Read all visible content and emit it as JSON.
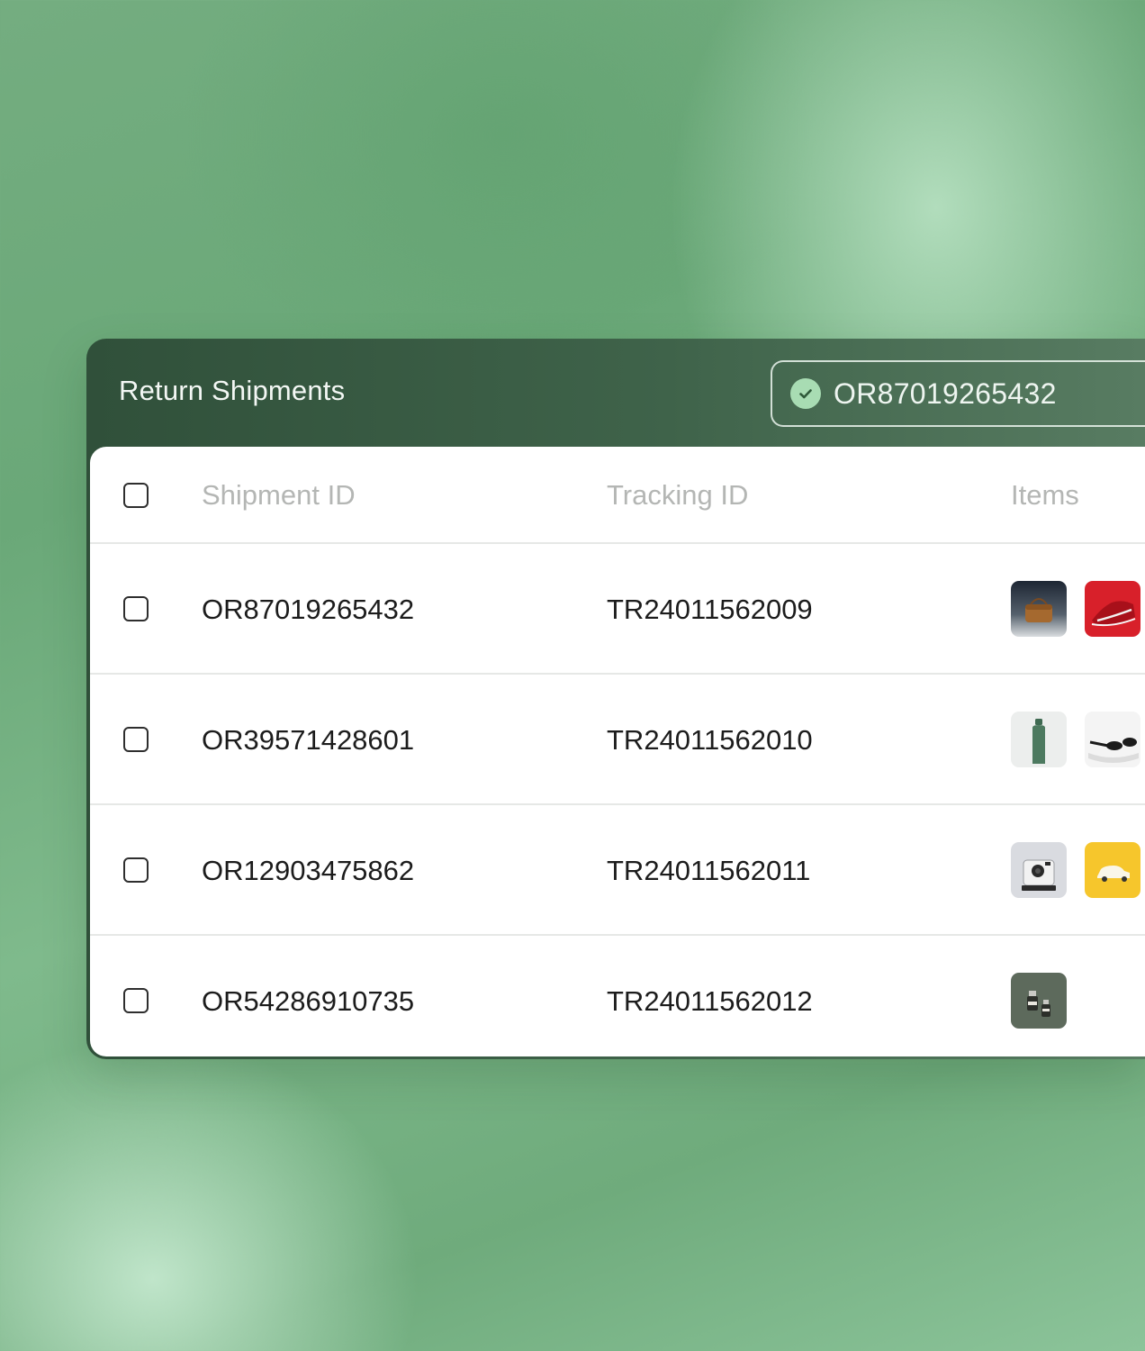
{
  "panel": {
    "title": "Return Shipments",
    "search_value": "OR87019265432"
  },
  "table": {
    "columns": [
      "Shipment ID",
      "Tracking ID",
      "Items"
    ],
    "rows": [
      {
        "shipment_id": "OR87019265432",
        "tracking_id": "TR24011562009",
        "items": [
          "leather-bag-thumbnail",
          "red-sneaker-thumbnail"
        ]
      },
      {
        "shipment_id": "OR39571428601",
        "tracking_id": "TR24011562010",
        "items": [
          "green-bottle-thumbnail",
          "sunglasses-thumbnail"
        ]
      },
      {
        "shipment_id": "OR12903475862",
        "tracking_id": "TR24011562011",
        "items": [
          "instant-camera-thumbnail",
          "toy-car-thumbnail"
        ]
      },
      {
        "shipment_id": "OR54286910735",
        "tracking_id": "TR24011562012",
        "items": [
          "serum-bottles-thumbnail"
        ]
      }
    ]
  },
  "colors": {
    "header_bg": "#3a5c44",
    "check_badge": "#a8dcb3",
    "background": "#74ad80"
  }
}
